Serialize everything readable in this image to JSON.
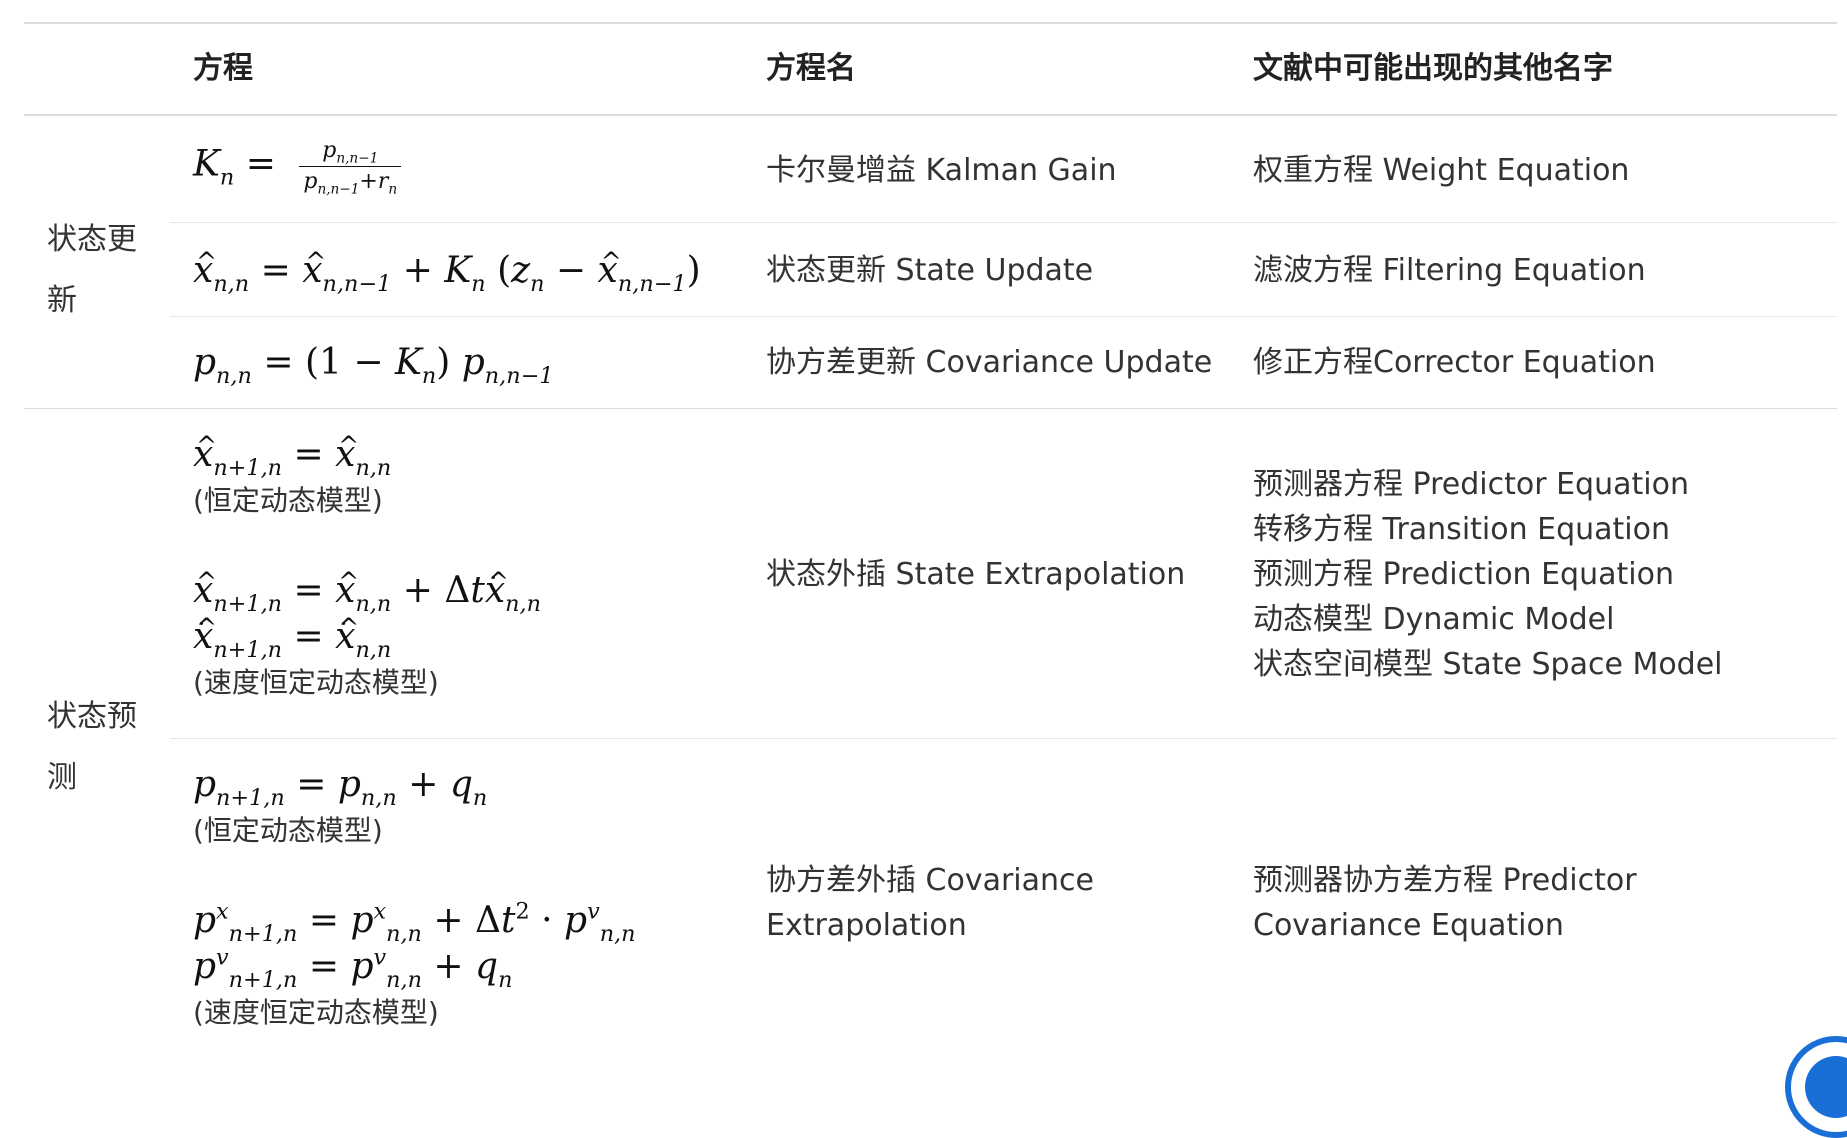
{
  "table": {
    "headers": {
      "equation": "方程",
      "name": "方程名",
      "other_names": "文献中可能出现的其他名字"
    },
    "groups": [
      {
        "label": "状态更新"
      },
      {
        "label": "状态预测"
      }
    ],
    "rows": [
      {
        "name": "卡尔曼增益 Kalman Gain",
        "other": [
          "权重方程 Weight Equation"
        ]
      },
      {
        "name": "状态更新 State Update",
        "other": [
          "滤波方程 Filtering Equation"
        ]
      },
      {
        "name": "协方差更新 Covariance Update",
        "other": [
          "修正方程Corrector Equation"
        ]
      },
      {
        "name": "状态外插 State Extrapolation",
        "notes": [
          "(恒定动态模型)",
          "(速度恒定动态模型)"
        ],
        "other": [
          "预测器方程 Predictor Equation",
          "转移方程 Transition Equation",
          "预测方程 Prediction Equation",
          "动态模型 Dynamic Model",
          "状态空间模型 State Space Model"
        ]
      },
      {
        "name": "协方差外插 Covariance Extrapolation",
        "notes": [
          "(恒定动态模型)",
          "(速度恒定动态模型)"
        ],
        "other": [
          "预测器协方差方程 Predictor Covariance Equation"
        ]
      }
    ]
  },
  "colors": {
    "accent": "#1a6fd6",
    "rule": "#dcdcdc"
  },
  "icons": {
    "scroll_button": "scroll-top-icon"
  }
}
